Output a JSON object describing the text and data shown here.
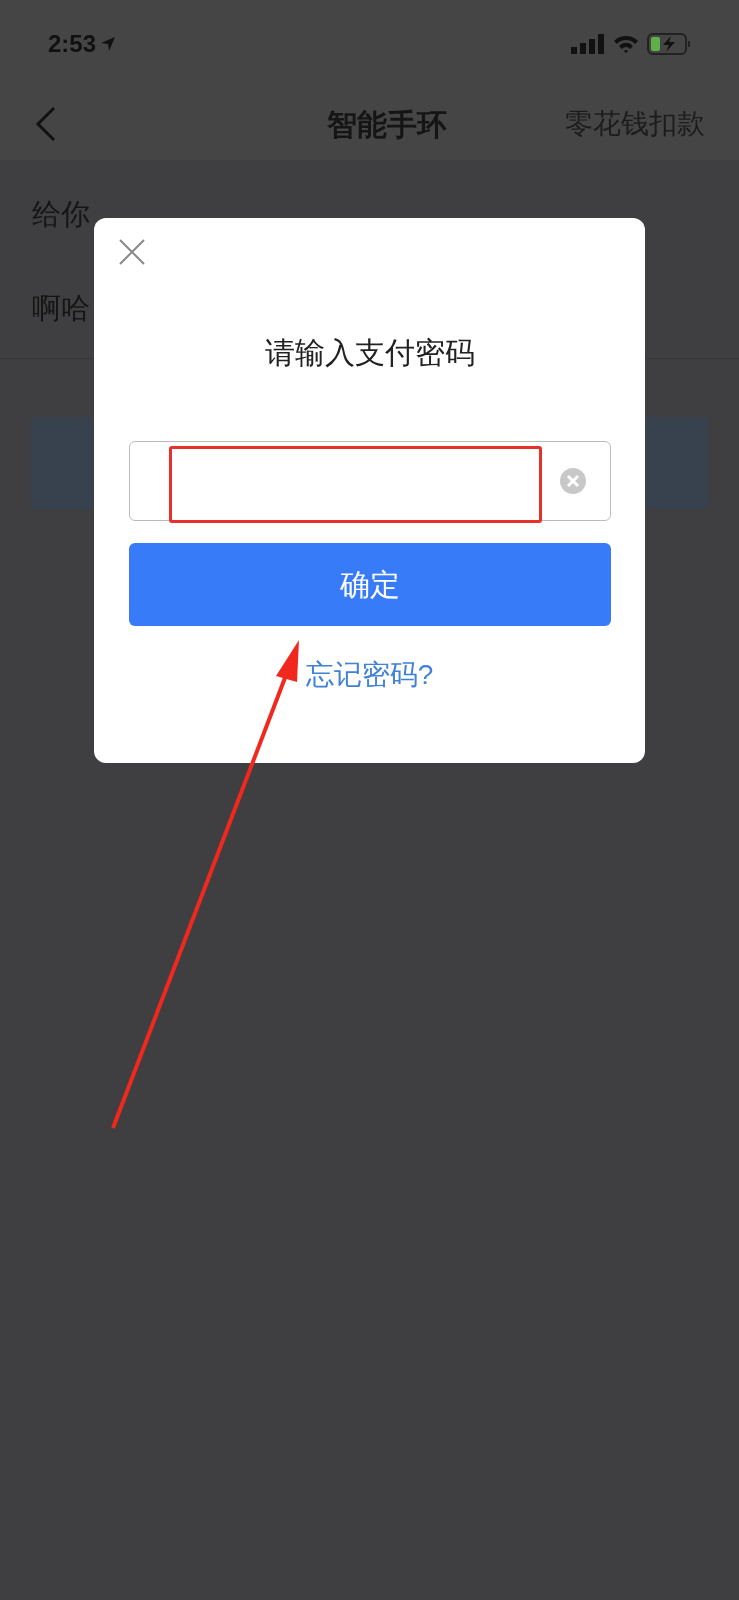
{
  "status_bar": {
    "time": "2:53"
  },
  "nav_bar": {
    "title": "智能手环",
    "action": "零花钱扣款"
  },
  "form_rows": [
    "给你",
    "啊哈"
  ],
  "dialog": {
    "title": "请输入支付密码",
    "button": "确定",
    "link": "忘记密码?"
  }
}
